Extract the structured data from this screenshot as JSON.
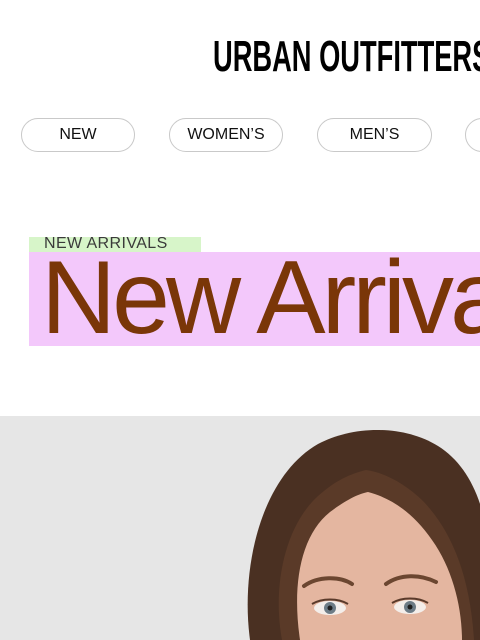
{
  "header": {
    "logo": "URBAN OUTFITTERS"
  },
  "nav": {
    "items": [
      {
        "label": "NEW"
      },
      {
        "label": "WOMEN’S"
      },
      {
        "label": "MEN’S"
      },
      {
        "label": ""
      }
    ]
  },
  "section": {
    "eyebrow": "NEW ARRIVALS",
    "headline": "New Arrivals"
  },
  "colors": {
    "eyebrow_highlight": "#d7f5c9",
    "headline_background": "#f3c8fb",
    "headline_text": "#7a3608",
    "hero_background": "#e6e6e6"
  }
}
